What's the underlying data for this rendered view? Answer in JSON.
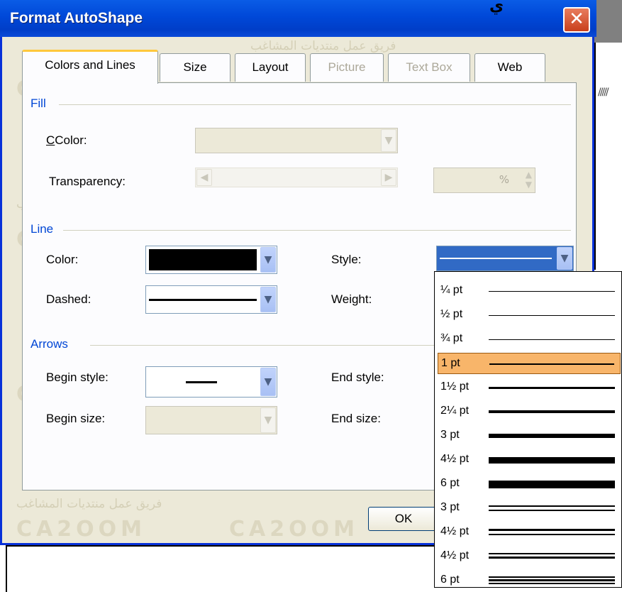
{
  "window": {
    "title": "Format AutoShape",
    "close_glyph": "✕",
    "background_text": "ي",
    "background_hatch": "/////"
  },
  "watermark": {
    "brand": "CA2OOM",
    "arabic": "فريق عمل منتديات المشاغب"
  },
  "tabs": [
    {
      "label": "Colors and Lines",
      "active": true,
      "enabled": true
    },
    {
      "label": "Size",
      "active": false,
      "enabled": true
    },
    {
      "label": "Layout",
      "active": false,
      "enabled": true
    },
    {
      "label": "Picture",
      "active": false,
      "enabled": false
    },
    {
      "label": "Text Box",
      "active": false,
      "enabled": false
    },
    {
      "label": "Web",
      "active": false,
      "enabled": true
    }
  ],
  "fill": {
    "section_title": "Fill",
    "color_label": "Color:",
    "transparency_label": "Transparency:",
    "transparency_value": "%",
    "enabled": false
  },
  "line": {
    "section_title": "Line",
    "color_label": "Color:",
    "color_value": "#000000",
    "dashed_label": "Dashed:",
    "style_label": "Style:",
    "weight_label": "Weight:"
  },
  "arrows": {
    "section_title": "Arrows",
    "begin_style_label": "Begin style:",
    "end_style_label": "End style:",
    "begin_size_label": "Begin size:",
    "end_size_label": "End size:"
  },
  "buttons": {
    "ok": "OK"
  },
  "style_list": {
    "selected_index": 3,
    "items": [
      {
        "label": "¼ pt",
        "weight": 0.25,
        "kind": "single"
      },
      {
        "label": "½ pt",
        "weight": 0.5,
        "kind": "single"
      },
      {
        "label": "¾ pt",
        "weight": 0.75,
        "kind": "single"
      },
      {
        "label": "1 pt",
        "weight": 1,
        "kind": "single"
      },
      {
        "label": "1½ pt",
        "weight": 1.5,
        "kind": "single"
      },
      {
        "label": "2¼ pt",
        "weight": 2.25,
        "kind": "single"
      },
      {
        "label": "3 pt",
        "weight": 3,
        "kind": "single"
      },
      {
        "label": "4½ pt",
        "weight": 4.5,
        "kind": "single"
      },
      {
        "label": "6 pt",
        "weight": 6,
        "kind": "single"
      },
      {
        "label": "3 pt",
        "weight": 3,
        "kind": "double"
      },
      {
        "label": "4½ pt",
        "weight": 4.5,
        "kind": "thick-thin"
      },
      {
        "label": "4½ pt",
        "weight": 4.5,
        "kind": "thin-thick"
      },
      {
        "label": "6 pt",
        "weight": 6,
        "kind": "triple"
      }
    ]
  },
  "colors": {
    "accent": "#0046d5",
    "selection": "#f8b56a",
    "title_bar": "#0048d8",
    "dialog_bg": "#ece9d8"
  },
  "icons": {
    "close": "close-icon",
    "dropdown": "chevron-down-icon",
    "scroll_left": "arrow-left-icon",
    "scroll_right": "arrow-right-icon",
    "spin": "spin-icon"
  }
}
